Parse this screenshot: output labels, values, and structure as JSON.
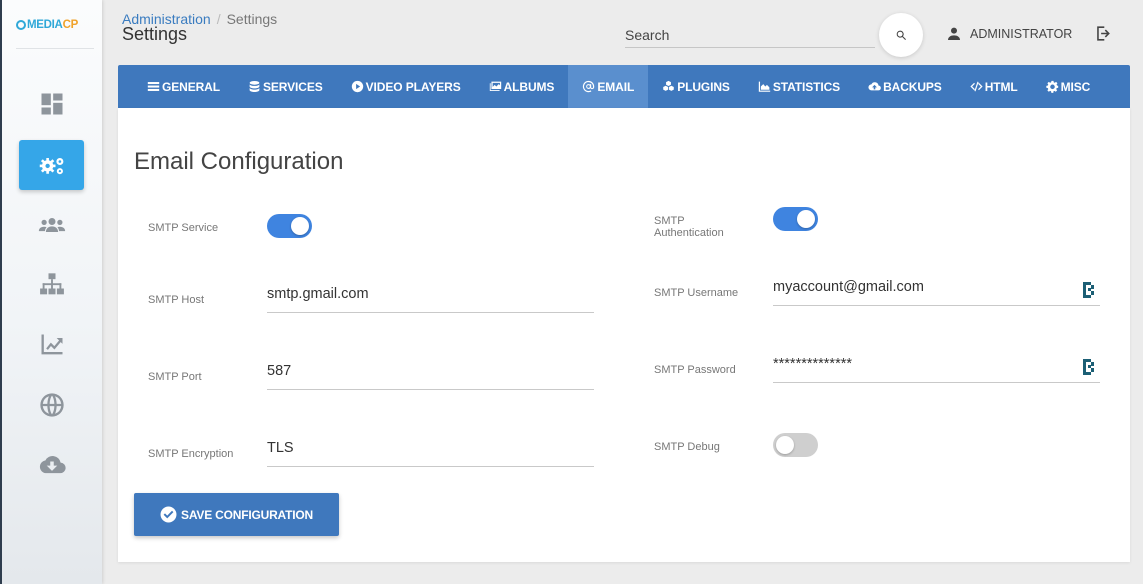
{
  "brand": {
    "logo_prefix": "MEDIA",
    "logo_suffix": "CP",
    "accent": "#35a6e8",
    "primary": "#3f78bd"
  },
  "sidebar": {
    "items": [
      {
        "icon": "dashboard-icon",
        "active": false
      },
      {
        "icon": "gears-icon",
        "active": true
      },
      {
        "icon": "users-icon",
        "active": false
      },
      {
        "icon": "sitemap-icon",
        "active": false
      },
      {
        "icon": "chart-line-icon",
        "active": false
      },
      {
        "icon": "globe-icon",
        "active": false
      },
      {
        "icon": "cloud-download-icon",
        "active": false
      }
    ]
  },
  "header": {
    "breadcrumb_root": "Administration",
    "breadcrumb_separator": "/",
    "breadcrumb_current": "Settings",
    "title": "Settings",
    "search_placeholder": "Search",
    "user_name": "ADMINISTRATOR"
  },
  "tabs": [
    {
      "label": "GENERAL",
      "icon": "bars-icon"
    },
    {
      "label": "SERVICES",
      "icon": "database-icon"
    },
    {
      "label": "VIDEO PLAYERS",
      "icon": "play-circle-icon"
    },
    {
      "label": "ALBUMS",
      "icon": "images-icon"
    },
    {
      "label": "EMAIL",
      "icon": "at-icon",
      "active": true
    },
    {
      "label": "PLUGINS",
      "icon": "cubes-icon"
    },
    {
      "label": "STATISTICS",
      "icon": "area-chart-icon"
    },
    {
      "label": "BACKUPS",
      "icon": "cloud-upload-icon"
    },
    {
      "label": "HTML",
      "icon": "code-icon"
    },
    {
      "label": "MISC",
      "icon": "cog-icon"
    }
  ],
  "email": {
    "title": "Email Configuration",
    "smtp_service_label": "SMTP Service",
    "smtp_service_enabled": true,
    "smtp_auth_label_line1": "SMTP",
    "smtp_auth_label_line2": "Authentication",
    "smtp_auth_enabled": true,
    "smtp_host_label": "SMTP Host",
    "smtp_host_value": "smtp.gmail.com",
    "smtp_username_label": "SMTP Username",
    "smtp_username_value": "myaccount@gmail.com",
    "smtp_port_label": "SMTP Port",
    "smtp_port_value": "587",
    "smtp_password_label": "SMTP Password",
    "smtp_password_value": "**************",
    "smtp_encryption_label": "SMTP Encryption",
    "smtp_encryption_value": "TLS",
    "smtp_debug_label": "SMTP Debug",
    "smtp_debug_enabled": false,
    "save_label": "SAVE CONFIGURATION"
  }
}
